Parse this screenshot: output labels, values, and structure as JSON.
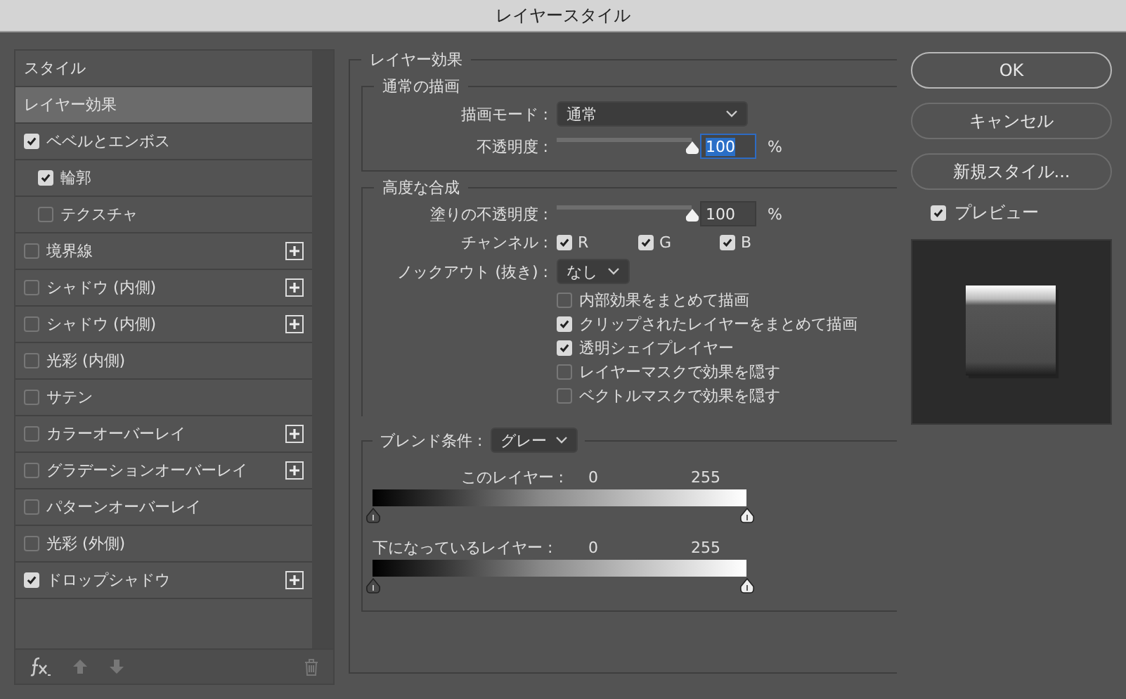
{
  "window": {
    "title": "レイヤースタイル"
  },
  "sidebar": {
    "items": [
      {
        "kind": "header",
        "label": "スタイル",
        "selected": false
      },
      {
        "kind": "header",
        "label": "レイヤー効果",
        "selected": true
      },
      {
        "kind": "effect",
        "label": "ベベルとエンボス",
        "checked": true,
        "selected": false,
        "addable": false,
        "children": [
          {
            "kind": "effect",
            "label": "輪郭",
            "checked": true,
            "selected": false,
            "addable": false
          },
          {
            "kind": "effect",
            "label": "テクスチャ",
            "checked": false,
            "selected": false,
            "addable": false
          }
        ]
      },
      {
        "kind": "effect",
        "label": "境界線",
        "checked": false,
        "selected": false,
        "addable": true
      },
      {
        "kind": "effect",
        "label": "シャドウ (内側)",
        "checked": false,
        "selected": false,
        "addable": true
      },
      {
        "kind": "effect",
        "label": "シャドウ (内側)",
        "checked": false,
        "selected": false,
        "addable": true
      },
      {
        "kind": "effect",
        "label": "光彩 (内側)",
        "checked": false,
        "selected": false,
        "addable": false
      },
      {
        "kind": "effect",
        "label": "サテン",
        "checked": false,
        "selected": false,
        "addable": false
      },
      {
        "kind": "effect",
        "label": "カラーオーバーレイ",
        "checked": false,
        "selected": false,
        "addable": true
      },
      {
        "kind": "effect",
        "label": "グラデーションオーバーレイ",
        "checked": false,
        "selected": false,
        "addable": true
      },
      {
        "kind": "effect",
        "label": "パターンオーバーレイ",
        "checked": false,
        "selected": false,
        "addable": false
      },
      {
        "kind": "effect",
        "label": "光彩 (外側)",
        "checked": false,
        "selected": false,
        "addable": false
      },
      {
        "kind": "effect",
        "label": "ドロップシャドウ",
        "checked": true,
        "selected": false,
        "addable": true
      }
    ]
  },
  "panel": {
    "title": "レイヤー効果",
    "normal": {
      "title": "通常の描画",
      "blend_mode": {
        "label": "描画モード :",
        "value": "通常"
      },
      "opacity": {
        "label": "不透明度 :",
        "level": 1,
        "value": "100",
        "focused": true,
        "unit": "%"
      }
    },
    "advanced": {
      "title": "高度な合成",
      "fill_opacity": {
        "label": "塗りの不透明度 :",
        "level": 1,
        "value": "100",
        "focused": false,
        "unit": "%"
      },
      "channels": {
        "label": "チャンネル :",
        "items": [
          {
            "label": "R",
            "checked": true
          },
          {
            "label": "G",
            "checked": true
          },
          {
            "label": "B",
            "checked": true
          }
        ]
      },
      "knockout": {
        "label": "ノックアウト (抜き) :",
        "value": "なし"
      },
      "options": [
        {
          "label": "内部効果をまとめて描画",
          "checked": false
        },
        {
          "label": "クリップされたレイヤーをまとめて描画",
          "checked": true
        },
        {
          "label": "透明シェイプレイヤー",
          "checked": true
        },
        {
          "label": "レイヤーマスクで効果を隠す",
          "checked": false
        },
        {
          "label": "ベクトルマスクで効果を隠す",
          "checked": false
        }
      ]
    },
    "blend_if": {
      "label": "ブレンド条件 :",
      "value": "グレー",
      "ranges": [
        {
          "label": "このレイヤー :",
          "low": "0",
          "high": "255"
        },
        {
          "label": "下になっているレイヤー :",
          "low": "0",
          "high": "255"
        }
      ]
    }
  },
  "buttons": [
    {
      "label": "OK",
      "default": true
    },
    {
      "label": "キャンセル",
      "default": false
    },
    {
      "label": "新規スタイル...",
      "default": false
    }
  ],
  "preview": {
    "label": "プレビュー",
    "checked": true
  }
}
